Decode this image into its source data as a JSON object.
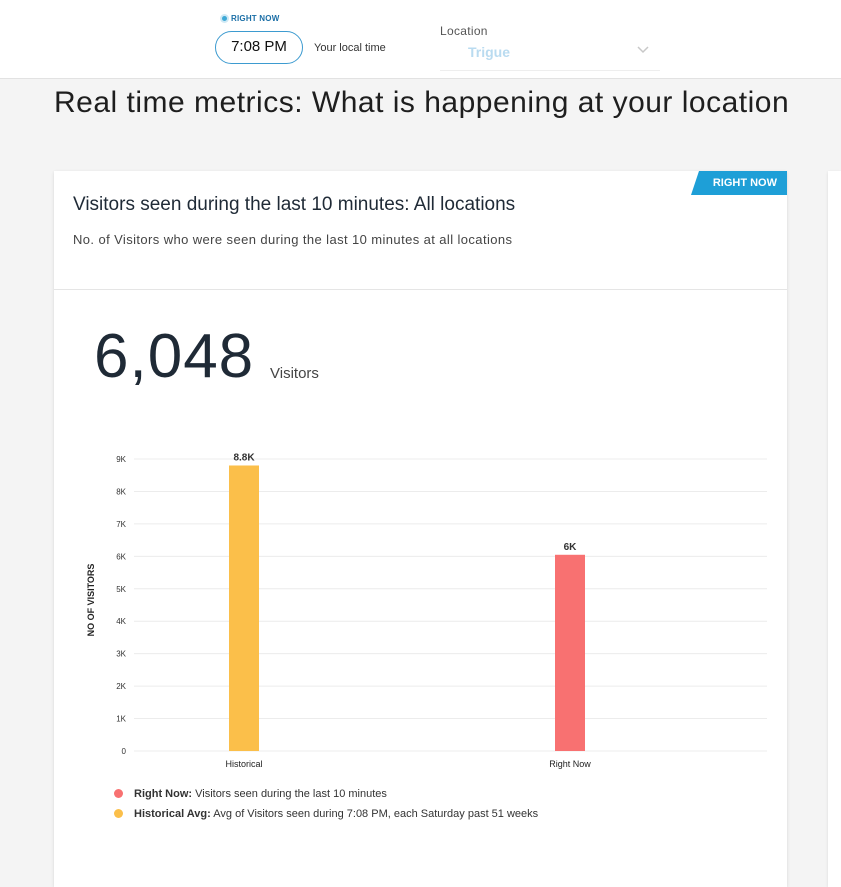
{
  "topbar": {
    "right_now_label": "RIGHT NOW",
    "time": "7:08 PM",
    "local_time_label": "Your local time",
    "location_label": "Location",
    "location_value": "Trigue"
  },
  "page_title": "Real time metrics: What is happening at your location",
  "card": {
    "badge": "RIGHT NOW",
    "title": "Visitors seen during the last 10 minutes: All locations",
    "subtitle": "No. of Visitors who were seen during the last 10 minutes at all locations",
    "big_number": "6,048",
    "big_unit": "Visitors"
  },
  "legend": [
    {
      "key": "Right Now:",
      "text": "Visitors seen during the last 10 minutes",
      "color": "#f87171"
    },
    {
      "key": "Historical Avg:",
      "text": "Avg of Visitors seen during 7:08 PM, each Saturday past 51 weeks",
      "color": "#fbbf4a"
    }
  ],
  "chart_data": {
    "type": "bar",
    "categories": [
      "Historical",
      "Right Now"
    ],
    "values": [
      8800,
      6048
    ],
    "data_labels": [
      "8.8K",
      "6K"
    ],
    "colors": [
      "#fbbf4a",
      "#f87171"
    ],
    "ylabel": "NO OF VISITORS",
    "xlabel": "",
    "ylim": [
      0,
      9000
    ],
    "yticks": [
      0,
      1000,
      2000,
      3000,
      4000,
      5000,
      6000,
      7000,
      8000,
      9000
    ],
    "ytick_labels": [
      "0",
      "1K",
      "2K",
      "3K",
      "4K",
      "5K",
      "6K",
      "7K",
      "8K",
      "9K"
    ],
    "grid": true
  }
}
